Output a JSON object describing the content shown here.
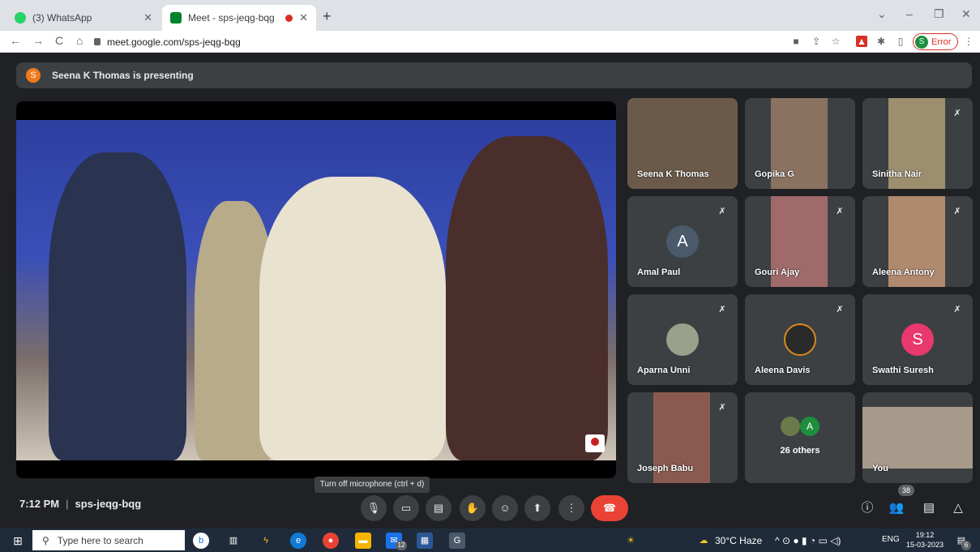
{
  "browser": {
    "tabs": [
      {
        "title": "(3) WhatsApp",
        "close": "✕",
        "favicon_color": "#25d366"
      },
      {
        "title": "Meet - sps-jeqg-bqg",
        "close": "✕",
        "favicon_color": "#00832d"
      }
    ],
    "new_tab": "+",
    "window_controls": [
      "⌄",
      "–",
      "❐",
      "✕"
    ],
    "nav": {
      "back": "←",
      "forward": "→",
      "reload": "C",
      "home": "⌂"
    },
    "url": "meet.google.com/sps-jeqg-bqg",
    "profile_initial": "S",
    "profile_status": "Error",
    "extensions": [
      "camera-icon",
      "share-icon",
      "star-icon",
      "pdf-icon",
      "puzzle-icon",
      "sidepanel-icon"
    ],
    "menu": "⋮"
  },
  "meet": {
    "presenter_initial": "S",
    "banner": "Seena K Thomas is presenting",
    "tooltip": "Turn off microphone (ctrl + d)",
    "time": "7:12 PM",
    "meeting_code": "sps-jeqg-bqg",
    "separator": "|",
    "people_count": "38",
    "participants": [
      {
        "name": "Seena K Thomas",
        "muted": false,
        "kind": "video",
        "color": "#6b5a4a"
      },
      {
        "name": "Gopika G",
        "muted": false,
        "kind": "video",
        "color": "#8a7260"
      },
      {
        "name": "Sinitha Nair",
        "muted": true,
        "kind": "video",
        "color": "#9d8f6e"
      },
      {
        "name": "Amal Paul",
        "muted": true,
        "kind": "avatar",
        "initial": "A",
        "color": "#4a5a6a"
      },
      {
        "name": "Gouri Ajay",
        "muted": true,
        "kind": "video",
        "color": "#a06a6a"
      },
      {
        "name": "Aleena Antony",
        "muted": true,
        "kind": "video",
        "color": "#b08a6e"
      },
      {
        "name": "Aparna Unni",
        "muted": true,
        "kind": "photo",
        "color": "#9aa08a"
      },
      {
        "name": "Aleena Davis",
        "muted": true,
        "kind": "photo",
        "color": "#2a2a2a"
      },
      {
        "name": "Swathi Suresh",
        "muted": true,
        "kind": "avatar",
        "initial": "S",
        "color": "#e8386d"
      },
      {
        "name": "Joseph Babu",
        "muted": true,
        "kind": "video",
        "color": "#8a5a50"
      },
      {
        "name": "26 others",
        "muted": false,
        "kind": "others",
        "initial": "A",
        "color": "#1e8e3e"
      },
      {
        "name": "You",
        "muted": false,
        "kind": "video",
        "color": "#a89a8a"
      }
    ]
  },
  "taskbar": {
    "search_placeholder": "Type here to search",
    "weather": "30°C Haze",
    "lang": "ENG",
    "clock_time": "19:12",
    "clock_date": "15-03-2023",
    "mail_badge": "12",
    "notif_badge": "6"
  }
}
